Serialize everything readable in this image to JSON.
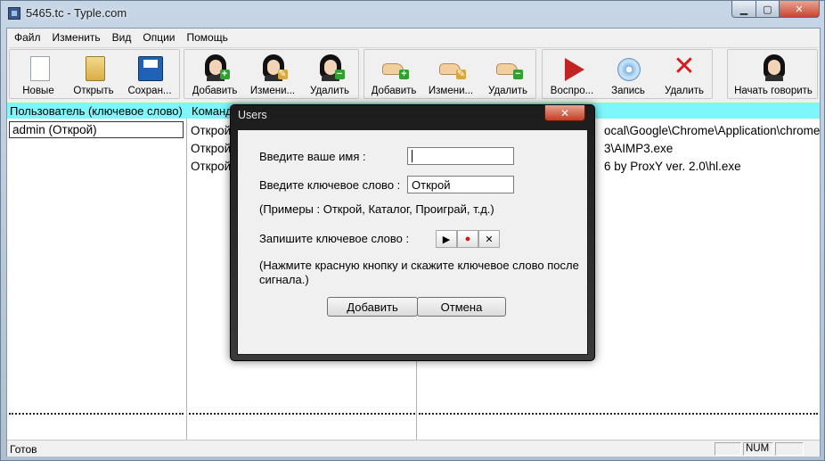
{
  "window": {
    "title": "5465.tc - Typle.com"
  },
  "menu": [
    {
      "label": "Файл"
    },
    {
      "label": "Изменить"
    },
    {
      "label": "Вид"
    },
    {
      "label": "Опции"
    },
    {
      "label": "Помощь"
    }
  ],
  "toolbar": {
    "new": "Новые",
    "open": "Открыть",
    "save": "Сохран...",
    "user_add": "Добавить",
    "user_edit": "Измени...",
    "user_delete": "Удалить",
    "cmd_add": "Добавить",
    "cmd_edit": "Измени...",
    "cmd_delete": "Удалить",
    "play": "Воспро...",
    "record": "Запись",
    "rec_delete": "Удалить",
    "start_speaking": "Начать говорить"
  },
  "list": {
    "header_user": "Пользователь (ключевое слово)",
    "header_command": "Команда",
    "user_row": "admin (Открой)",
    "command_rows": [
      "Открой",
      "Открой",
      "Открой"
    ],
    "path_rows": [
      "ocal\\Google\\Chrome\\Application\\chrome",
      "3\\AIMP3.exe",
      "6 by ProxY ver. 2.0\\hl.exe"
    ]
  },
  "status": {
    "text": "Готов",
    "num": "NUM"
  },
  "dialog": {
    "title": "Users",
    "name_label": "Введите ваше имя :",
    "name_value": "",
    "keyword_label": "Введите ключевое слово :",
    "keyword_value": "Открой",
    "examples": "(Примеры : Открой, Каталог, Проиграй, т.д.)",
    "record_label": "Запишите ключевое слово :",
    "hint": "(Нажмите красную кнопку и скажите ключевое слово после сигнала.)",
    "add_button": "Добавить",
    "cancel_button": "Отмена"
  }
}
